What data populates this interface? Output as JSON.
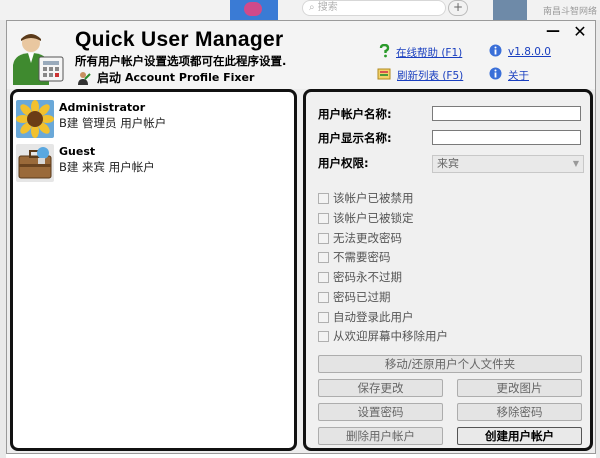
{
  "background": {
    "search_placeholder": "搜索",
    "right_text": "南昌斗智网络"
  },
  "window": {
    "title": "Quick User Manager",
    "subtitle": "所有用户帐户设置选项都可在此程序设置.",
    "launch_label": "启动",
    "launch_target": "Account Profile Fixer",
    "links": {
      "help": "在线帮助 (F1)",
      "version": "v1.8.0.0",
      "refresh": "刷新列表 (F5)",
      "about": "关于"
    },
    "minimize_glyph": "—",
    "close_glyph": "✕"
  },
  "users": [
    {
      "name": "Administrator",
      "description": "B建 管理员 用户帐户"
    },
    {
      "name": "Guest",
      "description": "B建 来宾 用户帐户"
    }
  ],
  "form": {
    "username_label": "用户帐户名称:",
    "displayname_label": "用户显示名称:",
    "rights_label": "用户权限:",
    "username_value": "",
    "displayname_value": "",
    "rights_value": "来宾",
    "checkboxes": [
      "该帐户已被禁用",
      "该帐户已被锁定",
      "无法更改密码",
      "不需要密码",
      "密码永不过期",
      "密码已过期",
      "自动登录此用户",
      "从欢迎屏幕中移除用户"
    ]
  },
  "buttons": {
    "move_profile": "移动/还原用户个人文件夹",
    "save": "保存更改",
    "change_picture": "更改图片",
    "set_password": "设置密码",
    "remove_password": "移除密码",
    "delete_user": "删除用户帐户",
    "create_user": "创建用户帐户"
  },
  "colors": {
    "accent_link": "#1a3fbf",
    "panel_border": "#111111"
  }
}
